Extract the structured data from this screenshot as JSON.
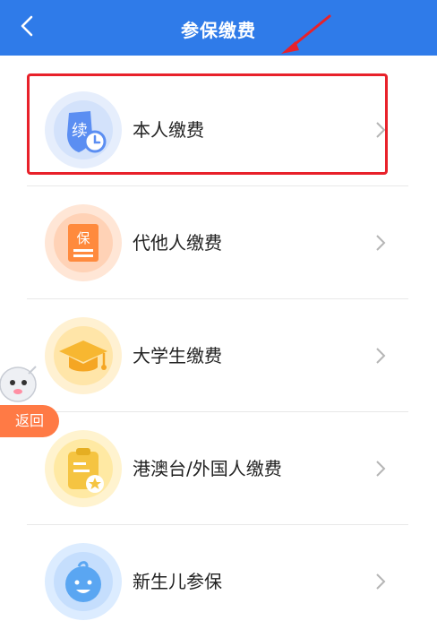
{
  "header": {
    "title": "参保缴费",
    "back_icon": "chevron-left-icon"
  },
  "items": [
    {
      "label": "本人缴费",
      "icon": "renewal-shield-icon",
      "bg": "#e6eefc",
      "color": "#5b8ef2"
    },
    {
      "label": "代他人缴费",
      "icon": "insurance-doc-icon",
      "bg": "#ffe6d6",
      "color": "#ff8a3d"
    },
    {
      "label": "大学生缴费",
      "icon": "graduation-cap-icon",
      "bg": "#fff1d2",
      "color": "#f7b731"
    },
    {
      "label": "港澳台/外国人缴费",
      "icon": "clipboard-star-icon",
      "bg": "#fff3cf",
      "color": "#f5c441"
    },
    {
      "label": "新生儿参保",
      "icon": "baby-face-icon",
      "bg": "#dcecff",
      "color": "#5aa6f2"
    }
  ],
  "float_button": {
    "label": "返回"
  },
  "colors": {
    "primary": "#2f7be9",
    "highlight": "#e8212a",
    "float": "#ff7a45"
  }
}
